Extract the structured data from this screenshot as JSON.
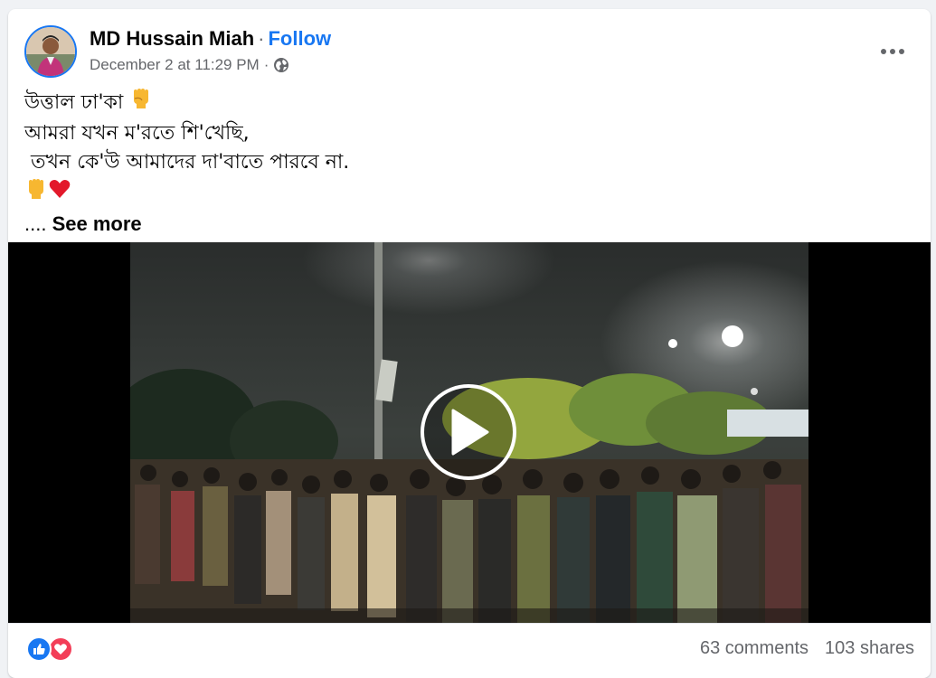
{
  "post": {
    "author": "MD Hussain Miah",
    "separator": "·",
    "follow_label": "Follow",
    "timestamp": "December 2 at 11:29 PM",
    "audience_icon": "globe-icon",
    "more_icon": "more-options-icon",
    "lines": [
      "উত্তাল ঢা'কা",
      "আমরা যখন ম'রতে শি'খেছি,",
      " তখন কে'উ আমাদের দা'বাতে পারবে না."
    ],
    "line1_emoji": "raised-fist-emoji",
    "emoji_line": [
      "raised-fist-emoji",
      "red-heart-emoji"
    ],
    "see_more_dots": "....",
    "see_more_label": "See more"
  },
  "video": {
    "play_icon": "play-icon"
  },
  "footer": {
    "reactions": [
      "like-reaction-icon",
      "love-reaction-icon"
    ],
    "comments": "63 comments",
    "shares": "103 shares"
  },
  "colors": {
    "brand_blue": "#1877f2",
    "love_red": "#f33e58",
    "secondary_text": "#65676b"
  }
}
